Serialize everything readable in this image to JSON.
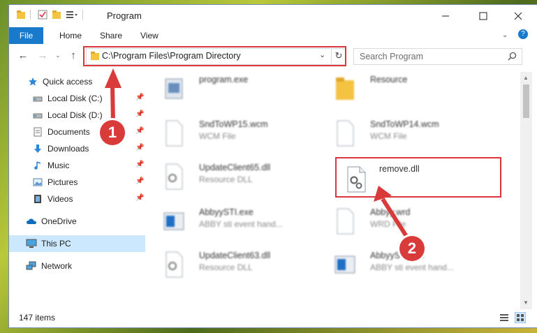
{
  "window": {
    "title": "Program"
  },
  "ribbon": {
    "tabs": [
      "File",
      "Home",
      "Share",
      "View"
    ]
  },
  "address": {
    "path": "C:\\Program Files\\Program Directory"
  },
  "search": {
    "placeholder": "Search Program"
  },
  "sidebar": {
    "items": [
      {
        "label": "Quick access",
        "icon": "star-icon"
      },
      {
        "label": "Local Disk (C:)",
        "icon": "drive-icon",
        "pinned": true
      },
      {
        "label": "Local Disk (D:)",
        "icon": "drive-icon",
        "pinned": true
      },
      {
        "label": "Documents",
        "icon": "document-icon",
        "pinned": true
      },
      {
        "label": "Downloads",
        "icon": "download-icon",
        "pinned": true
      },
      {
        "label": "Music",
        "icon": "music-icon",
        "pinned": true
      },
      {
        "label": "Pictures",
        "icon": "picture-icon",
        "pinned": true
      },
      {
        "label": "Videos",
        "icon": "video-icon",
        "pinned": true
      },
      {
        "label": "OneDrive",
        "icon": "cloud-icon"
      },
      {
        "label": "This PC",
        "icon": "computer-icon",
        "selected": true
      },
      {
        "label": "Network",
        "icon": "network-icon"
      }
    ]
  },
  "files": [
    {
      "name": "program.exe",
      "type": ""
    },
    {
      "name": "Resource",
      "type": ""
    },
    {
      "name": "SndToWP15.wcm",
      "type": "WCM File"
    },
    {
      "name": "SndToWP14.wcm",
      "type": "WCM File"
    },
    {
      "name": "UpdateClient65.dll",
      "type": "Resource DLL"
    },
    {
      "name": "remove.dll",
      "type": ""
    },
    {
      "name": "AbbyySTI.exe",
      "type": "ABBY sti event hand..."
    },
    {
      "name": "Abbyy.wrd",
      "type": "WRD File"
    },
    {
      "name": "UpdateClient63.dll",
      "type": "Resource DLL"
    },
    {
      "name": "AbbyySTI.exe",
      "type": "ABBY sti event hand..."
    }
  ],
  "status": {
    "items": "147 items"
  },
  "annotations": {
    "step1": "1",
    "step2": "2"
  },
  "colors": {
    "accent": "#1979ca",
    "highlight": "#d9363e",
    "selected": "#cce8ff"
  }
}
